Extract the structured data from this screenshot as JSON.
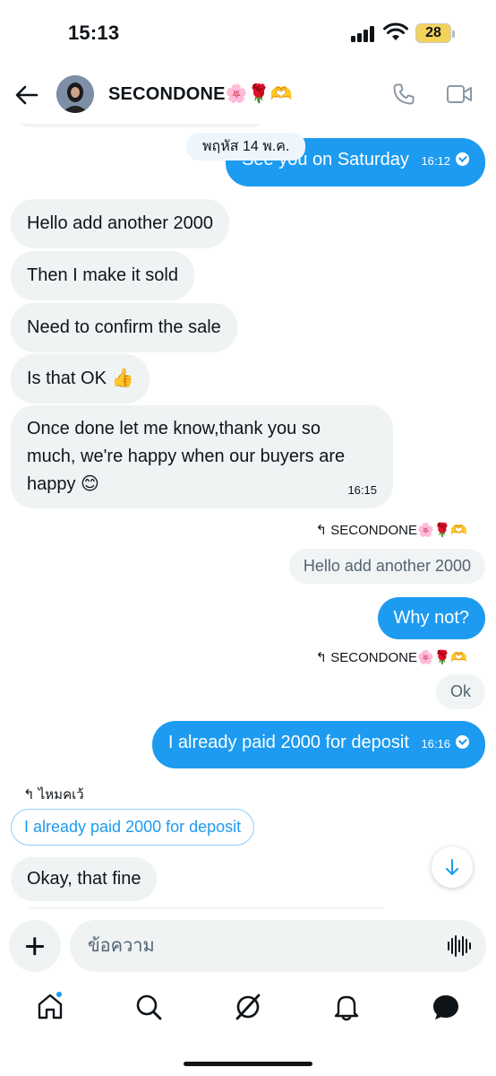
{
  "status_bar": {
    "time": "15:13",
    "battery": "28"
  },
  "header": {
    "name": "SECONDONE🌸🌹🫶"
  },
  "date_pill": "พฤหัส 14 พ.ค.",
  "messages": {
    "out1": {
      "text": "See you on Saturday",
      "time": "16:12"
    },
    "in1": "Hello add another 2000",
    "in2": "Then I make it sold",
    "in3": "Need to confirm the sale",
    "in4": "Is that OK 👍",
    "in5": {
      "line1": "Once done let me know,thank you so",
      "line2": "much, we're happy when our buyers are",
      "line3": "happy 😊",
      "time": "16:15"
    },
    "reply1": {
      "to": "SECONDONE🌸🌹🫶",
      "quote": "Hello add another 2000",
      "text": "Why not?"
    },
    "reply2": {
      "to": "SECONDONE🌸🌹🫶",
      "text": "Ok"
    },
    "out2": {
      "text": "I already paid 2000 for deposit",
      "time": "16:16"
    },
    "reply3": {
      "to": "ไหมคเว้",
      "quote": "I already paid 2000 for deposit",
      "text": "Okay, that fine"
    }
  },
  "compose": {
    "placeholder": "ข้อความ"
  },
  "colors": {
    "accent": "#1d9bf0",
    "bubble_in": "#eff3f4",
    "text": "#0f1419"
  },
  "icons": {
    "header": [
      "back-arrow-icon",
      "phone-icon",
      "video-icon"
    ],
    "tabs": [
      "home-icon",
      "search-icon",
      "grok-icon",
      "notifications-icon",
      "messages-icon"
    ]
  }
}
